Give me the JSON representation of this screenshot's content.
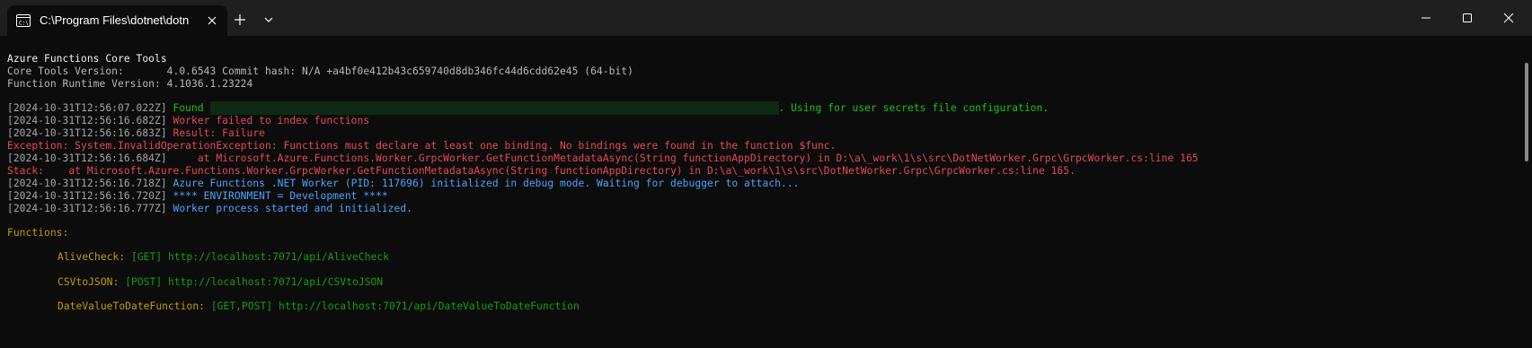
{
  "window": {
    "tab_title": "C:\\Program Files\\dotnet\\dotn",
    "icons": {
      "tab": "terminal-icon",
      "close": "close-icon",
      "new_tab": "plus-icon",
      "dropdown": "chevron-down-icon",
      "minimize": "minimize-icon",
      "maximize": "maximize-icon",
      "window_close": "close-icon"
    }
  },
  "colors": {
    "background": "#0c0c0c",
    "titlebar": "#1f1f1f",
    "green": "#16c60c",
    "red": "#e74856",
    "blue": "#3b78ff",
    "yellow": "#c19c00"
  },
  "terminal": {
    "header": {
      "title": "Azure Functions Core Tools",
      "core_version": "Core Tools Version:       4.0.6543 Commit hash: N/A +a4bf0e412b43c659740d8db346fc44d6cdd62e45 (64-bit)",
      "runtime_version": "Function Runtime Version: 4.1036.1.23224"
    },
    "log": [
      {
        "ts": "[2024-10-31T12:56:07.022Z]",
        "pre": "Found ",
        "post": ". Using for user secrets file configuration."
      },
      {
        "ts": "[2024-10-31T12:56:16.682Z]",
        "msg": "Worker failed to index functions"
      },
      {
        "ts": "[2024-10-31T12:56:16.683Z]",
        "msg": "Result: Failure"
      },
      {
        "msg": "Exception: System.InvalidOperationException: Functions must declare at least one binding. No bindings were found in the function $func."
      },
      {
        "ts": "[2024-10-31T12:56:16.684Z]",
        "msg": "    at Microsoft.Azure.Functions.Worker.GrpcWorker.GetFunctionMetadataAsync(String functionAppDirectory) in D:\\a\\_work\\1\\s\\src\\DotNetWorker.Grpc\\GrpcWorker.cs:line 165"
      },
      {
        "msg": "Stack:    at Microsoft.Azure.Functions.Worker.GrpcWorker.GetFunctionMetadataAsync(String functionAppDirectory) in D:\\a\\_work\\1\\s\\src\\DotNetWorker.Grpc\\GrpcWorker.cs:line 165."
      },
      {
        "ts": "[2024-10-31T12:56:16.718Z]",
        "msg": "Azure Functions .NET Worker (PID: 117696) initialized in debug mode. Waiting for debugger to attach..."
      },
      {
        "ts": "[2024-10-31T12:56:16.720Z]",
        "msg": "**** ENVIRONMENT = Development ****"
      },
      {
        "ts": "[2024-10-31T12:56:16.777Z]",
        "msg": "Worker process started and initialized."
      }
    ],
    "functions_heading": "Functions:",
    "functions": [
      {
        "name": "AliveCheck:",
        "methods": "[GET]",
        "url": "http://localhost:7071/api/AliveCheck"
      },
      {
        "name": "CSVtoJSON:",
        "methods": "[POST]",
        "url": "http://localhost:7071/api/CSVtoJSON"
      },
      {
        "name": "DateValueToDateFunction:",
        "methods": "[GET,POST]",
        "url": "http://localhost:7071/api/DateValueToDateFunction"
      }
    ]
  }
}
